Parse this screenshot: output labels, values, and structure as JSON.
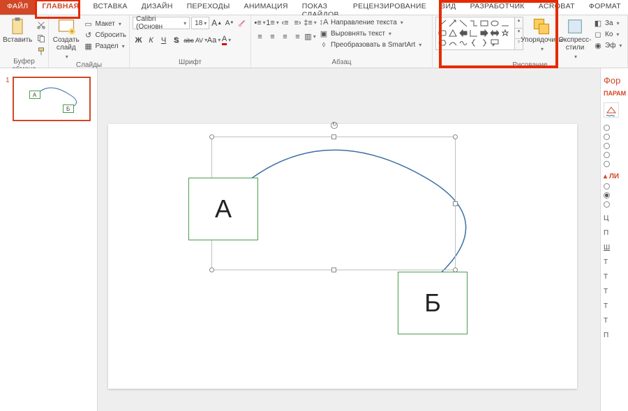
{
  "tabs": {
    "file": "ФАЙЛ",
    "home": "ГЛАВНАЯ",
    "insert": "ВСТАВКА",
    "design": "ДИЗАЙН",
    "transitions": "ПЕРЕХОДЫ",
    "animations": "АНИМАЦИЯ",
    "slideshow": "ПОКАЗ СЛАЙДОВ",
    "review": "РЕЦЕНЗИРОВАНИЕ",
    "view": "ВИД",
    "developer": "РАЗРАБОТЧИК",
    "acrobat": "ACROBAT",
    "format": "ФОРМАТ"
  },
  "ribbon": {
    "clipboard": {
      "paste": "Вставить",
      "label": "Буфер обмена"
    },
    "slides": {
      "new": "Создать слайд",
      "layout": "Макет",
      "reset": "Сбросить",
      "section": "Раздел",
      "label": "Слайды"
    },
    "font": {
      "name": "Calibri (Основн",
      "size": "18",
      "label": "Шрифт",
      "bold": "Ж",
      "italic": "К",
      "underline": "Ч",
      "shadow": "S",
      "strike": "abc",
      "spacing": "AV",
      "case": "Aa",
      "color": "A"
    },
    "paragraph": {
      "label": "Абзац",
      "textdir": "Направление текста",
      "align": "Выровнять текст",
      "smartart": "Преобразовать в SmartArt"
    },
    "drawing": {
      "arrange": "Упорядочить",
      "styles": "Экспресс-стили",
      "fill": "За",
      "outline": "Ко",
      "effects": "Эф",
      "label": "Рисование"
    }
  },
  "thumb": {
    "num": "1",
    "a": "А",
    "b": "Б"
  },
  "slide": {
    "a": "А",
    "b": "Б"
  },
  "pane": {
    "title": "Фор",
    "sub": "ПАРАМ",
    "line": "ЛИ",
    "items": [
      "Ц",
      "П",
      "Ш",
      "Т",
      "Т",
      "Т",
      "Т",
      "Т",
      "П"
    ]
  }
}
